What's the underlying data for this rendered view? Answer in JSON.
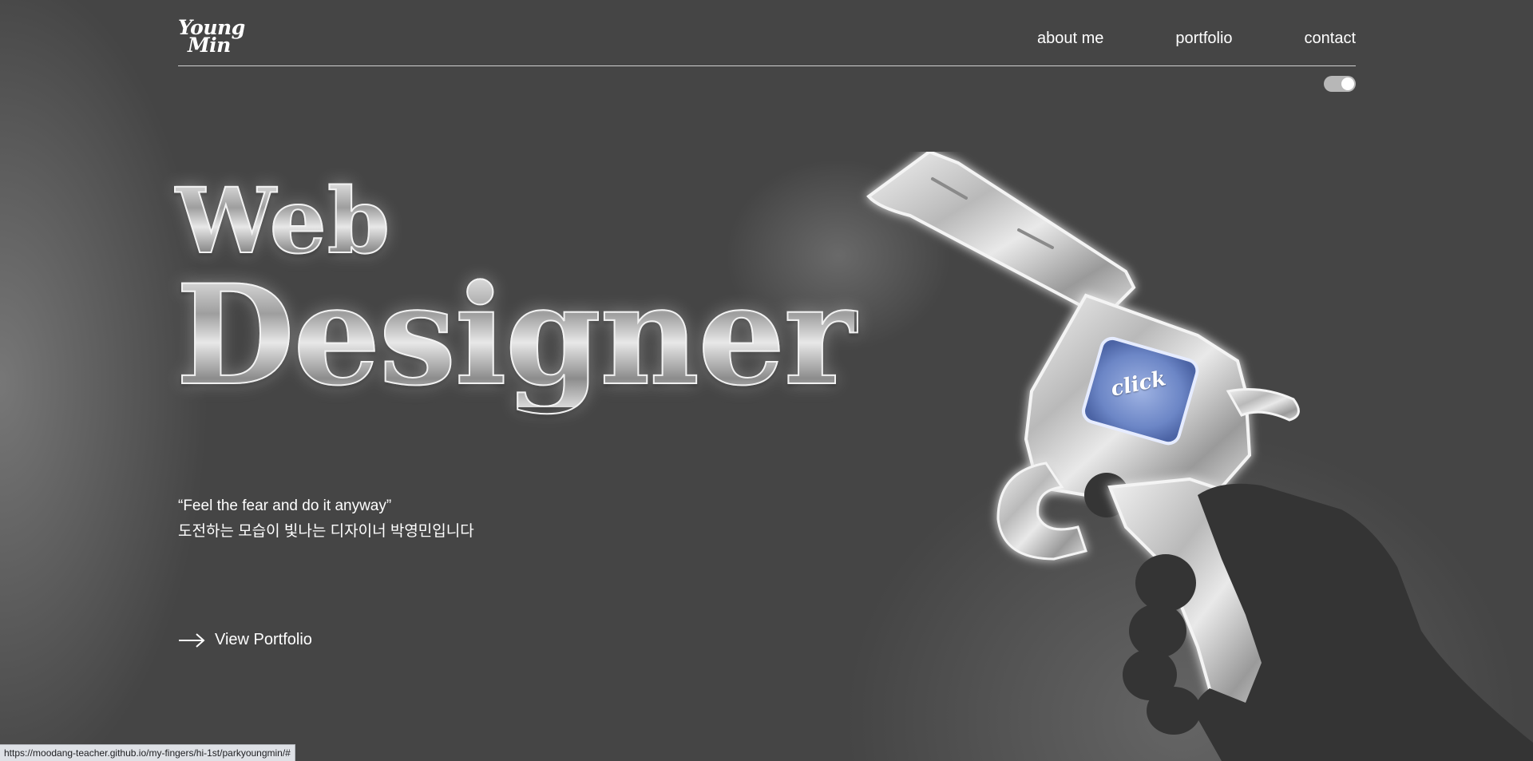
{
  "logo": {
    "line1": "Young",
    "line2": "Min"
  },
  "nav": {
    "items": [
      {
        "label": "about me"
      },
      {
        "label": "portfolio"
      },
      {
        "label": "contact"
      }
    ]
  },
  "theme_toggle": {
    "state": "on"
  },
  "hero": {
    "title_line1": "Web",
    "title_line2": "Designer",
    "quote_en": "“Feel the fear and do it anyway”",
    "quote_ko": "도전하는 모습이 빛나는 디자이너 박영민입니다",
    "cta_label": "View Portfolio",
    "cta_icon": "arrow-right-icon"
  },
  "illustration": {
    "subject": "revolver-with-hand",
    "button_label": "click",
    "button_color": "#6c86c6"
  },
  "status_bar": {
    "url": "https://moodang-teacher.github.io/my-fingers/hi-1st/parkyoungmin/#"
  },
  "colors": {
    "background": "#454545",
    "text": "#ffffff",
    "hand": "#343434",
    "chrome": "#d9d9d9"
  }
}
